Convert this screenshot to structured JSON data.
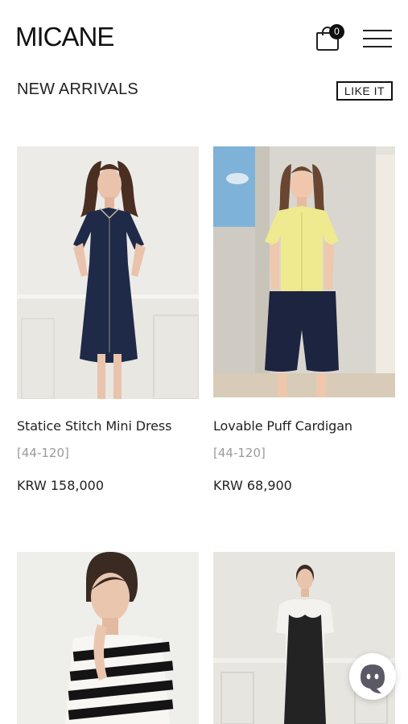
{
  "header": {
    "logo": "MICANE",
    "cart_count": "0"
  },
  "section": {
    "title": "NEW ARRIVALS",
    "like_button": "LIKE IT"
  },
  "products": [
    {
      "name": "Statice Stitch Mini Dress",
      "size": "[44-120]",
      "price": "KRW 158,000"
    },
    {
      "name": "Lovable Puff Cardigan",
      "size": "[44-120]",
      "price": "KRW 68,900"
    }
  ],
  "icons": [
    "cart-icon",
    "hamburger-menu-icon",
    "chat-icon"
  ]
}
